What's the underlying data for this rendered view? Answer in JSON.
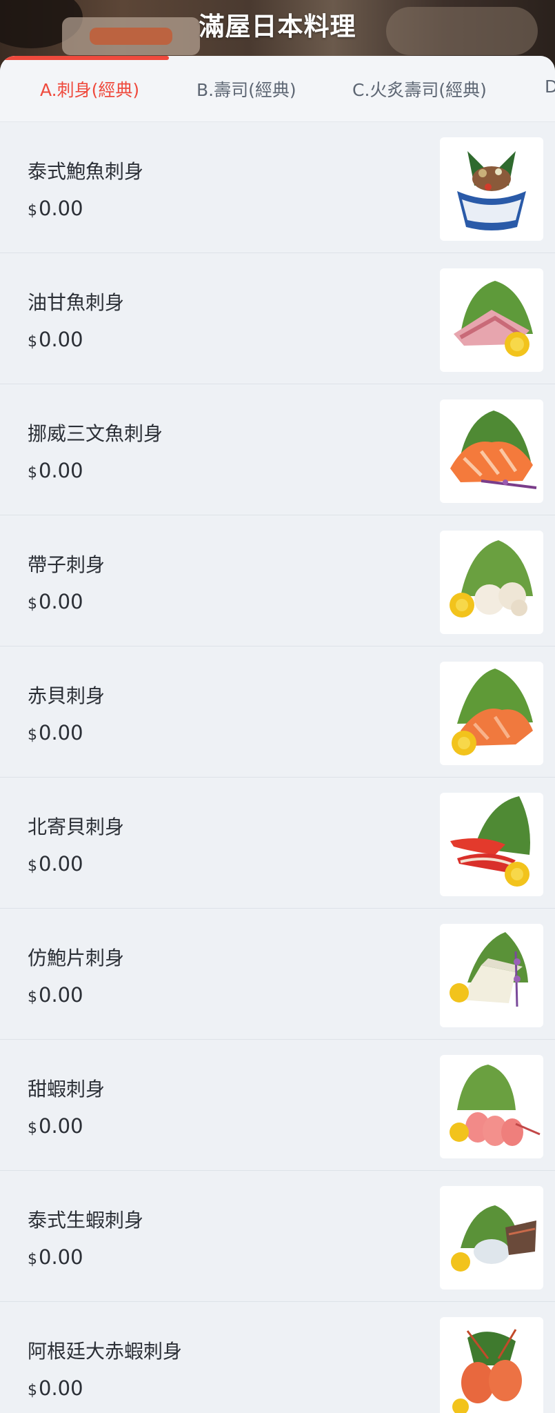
{
  "header": {
    "title": "滿屋日本料理"
  },
  "tabs": [
    {
      "label": "A.刺身(經典)"
    },
    {
      "label": "B.壽司(經典)"
    },
    {
      "label": "C.火炙壽司(經典)"
    },
    {
      "label": "D"
    }
  ],
  "items": [
    {
      "name": "泰式鮑魚刺身",
      "currency": "$",
      "price": "0.00",
      "image": "abalone-dish-image"
    },
    {
      "name": "油甘魚刺身",
      "currency": "$",
      "price": "0.00",
      "image": "yellowtail-sashimi-image"
    },
    {
      "name": "挪威三文魚刺身",
      "currency": "$",
      "price": "0.00",
      "image": "salmon-sashimi-image"
    },
    {
      "name": "帶子刺身",
      "currency": "$",
      "price": "0.00",
      "image": "scallop-sashimi-image"
    },
    {
      "name": "赤貝刺身",
      "currency": "$",
      "price": "0.00",
      "image": "ark-shell-sashimi-image"
    },
    {
      "name": "北寄貝刺身",
      "currency": "$",
      "price": "0.00",
      "image": "surf-clam-sashimi-image"
    },
    {
      "name": "仿鮑片刺身",
      "currency": "$",
      "price": "0.00",
      "image": "imitation-abalone-sashimi-image"
    },
    {
      "name": "甜蝦刺身",
      "currency": "$",
      "price": "0.00",
      "image": "sweet-shrimp-sashimi-image"
    },
    {
      "name": "泰式生蝦刺身",
      "currency": "$",
      "price": "0.00",
      "image": "thai-raw-shrimp-image"
    },
    {
      "name": "阿根廷大赤蝦刺身",
      "currency": "$",
      "price": "0.00",
      "image": "argentine-red-shrimp-image"
    }
  ],
  "colors": {
    "accent": "#ef4a3d",
    "background": "#eef1f5",
    "text": "#2b2f36",
    "tab_text": "#5d6673"
  }
}
